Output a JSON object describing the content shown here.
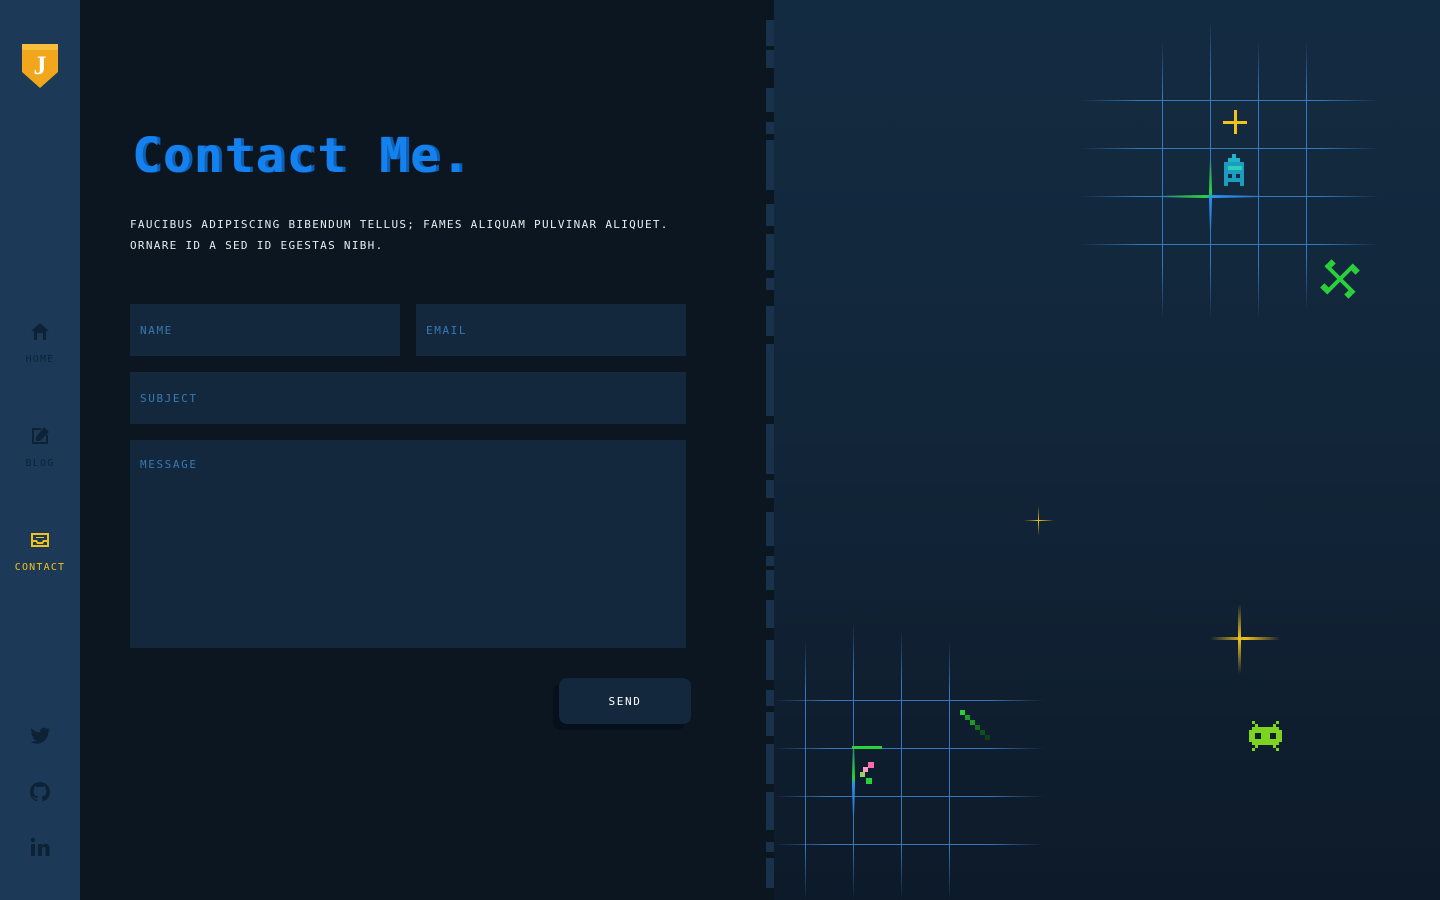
{
  "brand": {
    "logo_letter": "J",
    "logo_color": "#f2a61b"
  },
  "nav": {
    "items": [
      {
        "label": "Home",
        "icon": "home-icon",
        "active": false
      },
      {
        "label": "Blog",
        "icon": "edit-icon",
        "active": false
      },
      {
        "label": "Contact",
        "icon": "inbox-icon",
        "active": true
      }
    ]
  },
  "social": [
    {
      "icon": "twitter-icon"
    },
    {
      "icon": "github-icon"
    },
    {
      "icon": "linkedin-icon"
    }
  ],
  "contact": {
    "title": "Contact Me.",
    "intro": "Faucibus adipiscing bibendum tellus; fames aliquam pulvinar aliquet. Ornare id a sed id egestas nibh.",
    "name_placeholder": "Name",
    "email_placeholder": "Email",
    "subject_placeholder": "Subject",
    "message_placeholder": "Message",
    "send_label": "Send"
  },
  "colors": {
    "accent_blue": "#1481ef",
    "accent_yellow": "#f2c21b",
    "sidebar_bg": "#1c3a57",
    "panel_bg": "#0c1621",
    "field_bg": "#13283d"
  }
}
